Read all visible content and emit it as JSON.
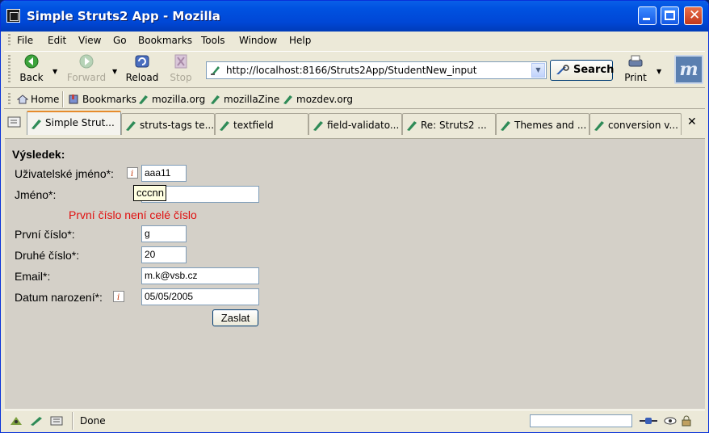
{
  "window": {
    "title": "Simple Struts2 App - Mozilla"
  },
  "menu": [
    "File",
    "Edit",
    "View",
    "Go",
    "Bookmarks",
    "Tools",
    "Window",
    "Help"
  ],
  "nav": {
    "back": "Back",
    "forward": "Forward",
    "reload": "Reload",
    "stop": "Stop",
    "url": "http://localhost:8166/Struts2App/StudentNew_input",
    "search": "Search",
    "print": "Print"
  },
  "bookmarks": [
    "Home",
    "Bookmarks",
    "mozilla.org",
    "mozillaZine",
    "mozdev.org"
  ],
  "tabs": [
    "Simple Strut...",
    "struts-tags te...",
    "textfield",
    "field-validato...",
    "Re: Struts2 ...",
    "Themes and ...",
    "conversion v..."
  ],
  "tab_close": "✕",
  "form": {
    "heading": "Výsledek:",
    "username_label": "Uživatelské jméno*:",
    "username_value": "aaa11",
    "name_label": "Jméno*:",
    "name_tooltip": "cccnn",
    "error": "První číslo není celé číslo",
    "first_label": "První číslo*:",
    "first_value": "g",
    "second_label": "Druhé číslo*:",
    "second_value": "20",
    "email_label": "Email*:",
    "email_value": "m.k@vsb.cz",
    "birth_label": "Datum narození*:",
    "birth_value": "05/05/2005",
    "submit": "Zaslat"
  },
  "status": {
    "text": "Done"
  },
  "colors": {
    "title_bar": "#0054e3",
    "error": "#e01010",
    "content_bg": "#d4d0c8"
  }
}
